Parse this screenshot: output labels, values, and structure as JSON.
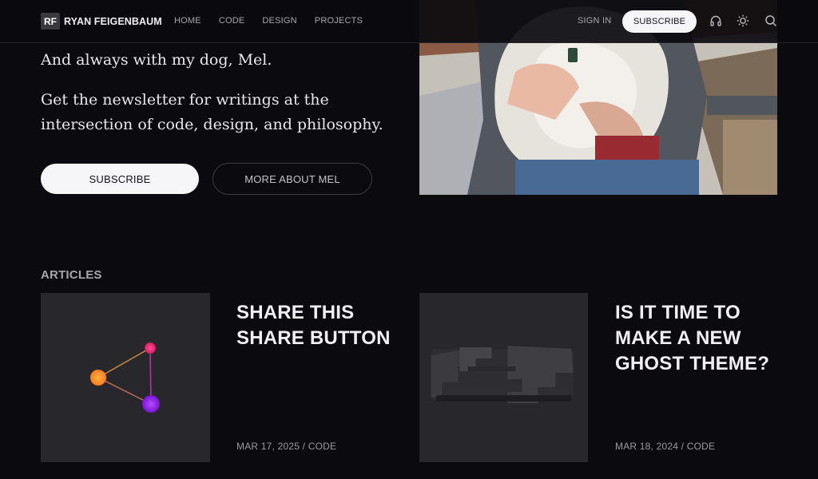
{
  "header": {
    "logo_mark": "RF",
    "logo_name": "RYAN FEIGENBAUM",
    "nav": [
      "HOME",
      "CODE",
      "DESIGN",
      "PROJECTS"
    ],
    "signin": "SIGN IN",
    "subscribe": "SUBSCRIBE",
    "icons": [
      "headphones-icon",
      "sun-icon",
      "search-icon"
    ]
  },
  "hero": {
    "line_dog": "And always with my dog, Mel.",
    "line_newsletter": "Get the newsletter for writings at the intersection of code, design, and philosophy.",
    "subscribe_button": "SUBSCRIBE",
    "more_button": "MORE ABOUT MEL"
  },
  "articles": {
    "heading": "ARTICLES",
    "items": [
      {
        "title": "SHARE THIS SHARE BUTTON",
        "date": "MAR 17, 2025",
        "tag": "CODE"
      },
      {
        "title": "IS IT TIME TO MAKE A NEW GHOST THEME?",
        "date": "MAR 18, 2024",
        "tag": "CODE"
      }
    ]
  },
  "colors": {
    "background": "#0b0a0e",
    "text": "#e8e6ea",
    "muted": "#a8a6ac",
    "button_light": "#f6f5f7"
  }
}
